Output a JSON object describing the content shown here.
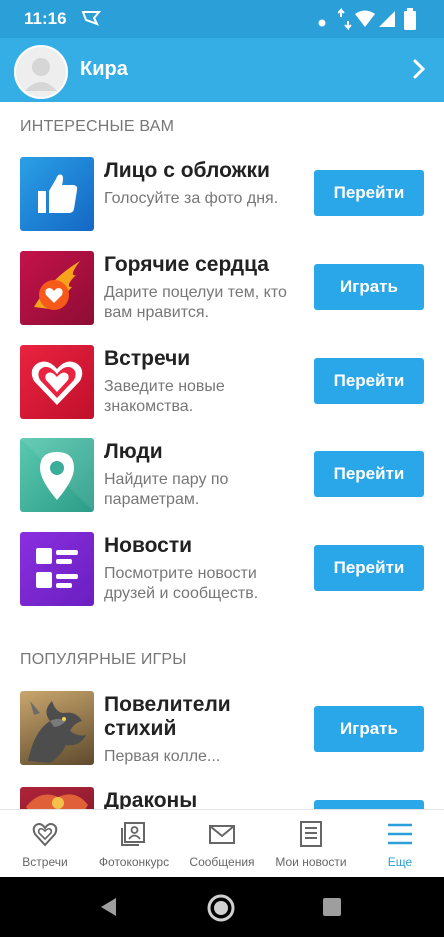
{
  "status_bar": {
    "time": "11:16"
  },
  "header": {
    "user_name": "Кира"
  },
  "sections": {
    "interesting": "ИНТЕРЕСНЫЕ ВАМ",
    "popular_games": "ПОПУЛЯРНЫЕ ИГРЫ"
  },
  "items": [
    {
      "title": "Лицо с обложки",
      "desc": "Голосуйте за фото дня.",
      "button": "Перейти",
      "icon": "thumbs-up-icon"
    },
    {
      "title": "Горячие сердца",
      "desc": "Дарите поцелуи тем, кто вам нравится.",
      "button": "Играть",
      "icon": "flaming-heart-icon"
    },
    {
      "title": "Встречи",
      "desc": "Заведите новые знакомства.",
      "button": "Перейти",
      "icon": "heart-icon"
    },
    {
      "title": "Люди",
      "desc": "Найдите пару по параметрам.",
      "button": "Перейти",
      "icon": "location-pin-icon"
    },
    {
      "title": "Новости",
      "desc": "Посмотрите новости друзей и сообществ.",
      "button": "Перейти",
      "icon": "news-list-icon"
    }
  ],
  "games": [
    {
      "title": "Повелители стихий",
      "desc": "Первая колле...",
      "button": "Играть",
      "icon": "dragon-game-icon"
    },
    {
      "title": "Драконы",
      "desc": "",
      "button": "",
      "icon": "dragon-red-game-icon"
    }
  ],
  "bottom_nav": [
    {
      "label": "Встречи",
      "icon": "heart-outline-icon"
    },
    {
      "label": "Фотоконкурс",
      "icon": "photo-portrait-icon"
    },
    {
      "label": "Сообщения",
      "icon": "envelope-icon"
    },
    {
      "label": "Мои новости",
      "icon": "document-lines-icon"
    },
    {
      "label": "Еще",
      "icon": "menu-lines-icon",
      "active": true
    }
  ],
  "colors": {
    "statusbar": "#2a9fd8",
    "header": "#35aee6",
    "button": "#2aa7e8",
    "active_nav": "#2a9fd8"
  }
}
